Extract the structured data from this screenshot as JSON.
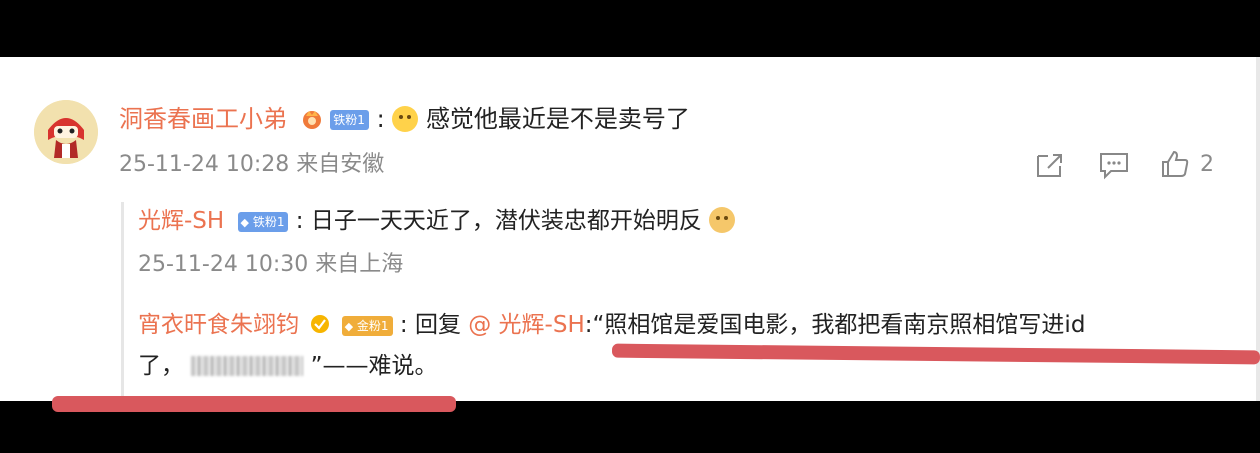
{
  "comment": {
    "username": "洞香春画工小弟",
    "fan_badge": "铁粉1",
    "separator": ":",
    "text": "感觉他最近是不是卖号了",
    "timestamp": "25-11-24 10:28",
    "location": "来自安徽",
    "like_count": "2"
  },
  "replies": [
    {
      "username": "光辉-SH",
      "fan_badge": "铁粉1",
      "separator": ":",
      "text": "日子一天天近了，潜伏装忠都开始明反",
      "timestamp": "25-11-24 10:30",
      "location": "来自上海"
    },
    {
      "username": "宵衣旰食朱翊钧",
      "fan_badge": "金粉1",
      "separator": ":",
      "reply_prefix": "回复",
      "mention": "@ 光辉-SH",
      "text_line1": ":“照相馆是爱国电影，我都把看南京照相馆写进id",
      "text_line2_pre": "了，",
      "text_line2_post": "”——难说。"
    }
  ],
  "colors": {
    "username": "#eb7350",
    "mention": "#eb7350",
    "meta": "#8a8a8a",
    "iron_badge": "#6b9eea",
    "gold_badge": "#f0ad3a",
    "annotation_line": "#d9585d"
  }
}
